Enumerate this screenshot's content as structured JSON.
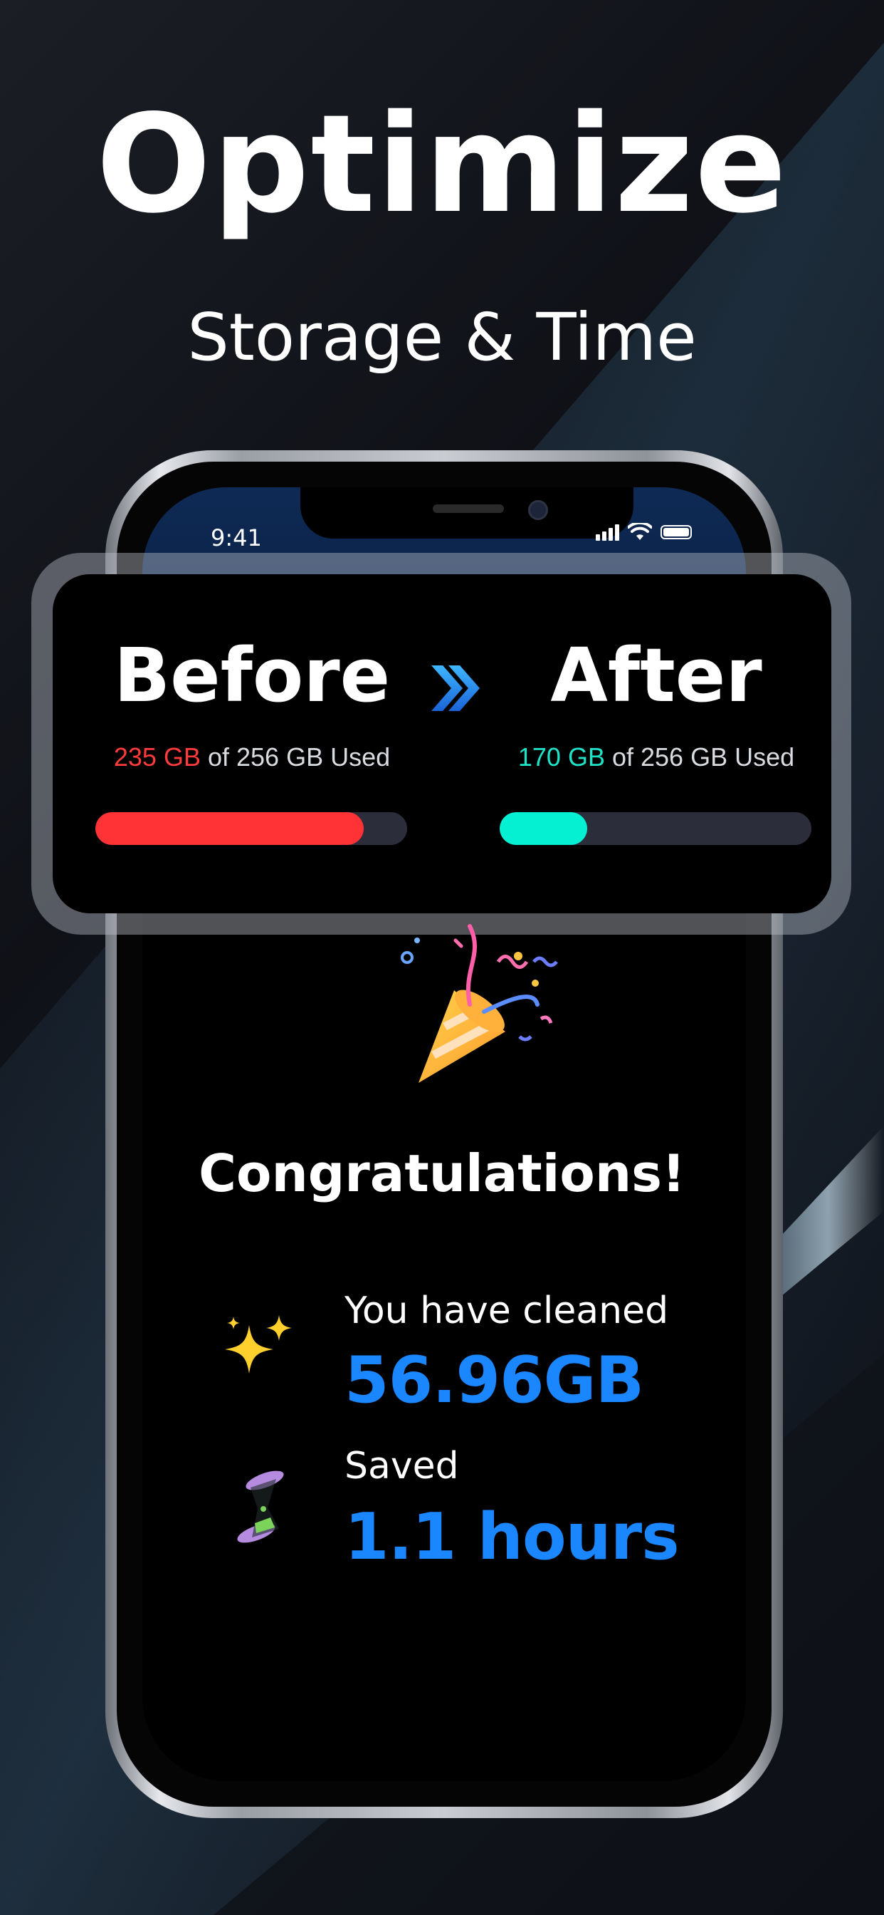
{
  "headline": {
    "title": "Optimize",
    "subtitle": "Storage & Time"
  },
  "status_bar": {
    "time": "9:41"
  },
  "comparison": {
    "before": {
      "heading": "Before",
      "used_amount": "235 GB",
      "used_suffix": " of 256 GB Used",
      "fill_fraction": 0.86,
      "color": "#ff3236"
    },
    "after": {
      "heading": "After",
      "used_amount": "170 GB",
      "used_suffix": " of 256 GB Used",
      "fill_fraction": 0.28,
      "color": "#05f0d2"
    }
  },
  "result": {
    "congrats": "Congratulations!",
    "cleaned_label": "You have cleaned",
    "cleaned_value": "56.96GB",
    "saved_label": "Saved",
    "saved_value": "1.1 hours"
  },
  "icons": {
    "arrows": "double-chevron-right",
    "party": "party-popper",
    "sparkles": "sparkles",
    "hourglass": "hourglass"
  },
  "colors": {
    "accent_blue": "#1a86ff",
    "before_red": "#ff3236",
    "after_teal": "#05f0d2"
  }
}
